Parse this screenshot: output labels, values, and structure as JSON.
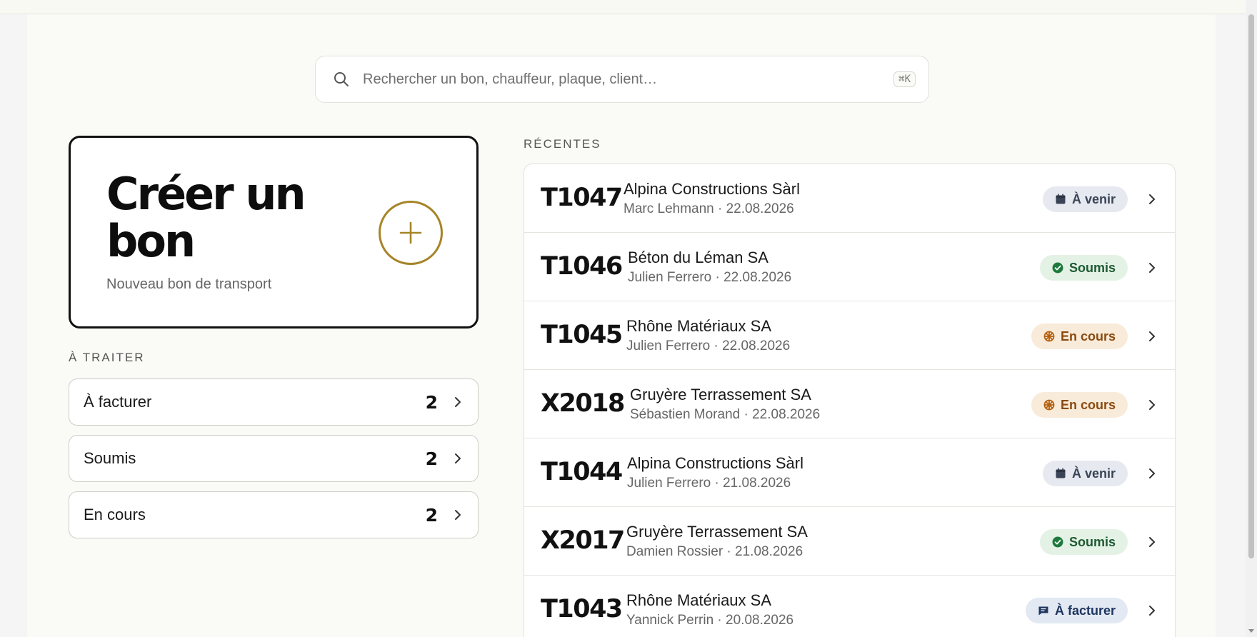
{
  "search": {
    "placeholder": "Rechercher un bon, chauffeur, plaque, client…",
    "shortcut": "⌘K"
  },
  "create_card": {
    "title": "Créer un bon",
    "subtitle": "Nouveau bon de transport"
  },
  "todo": {
    "label": "À TRAITER",
    "items": [
      {
        "label": "À facturer",
        "count": "2"
      },
      {
        "label": "Soumis",
        "count": "2"
      },
      {
        "label": "En cours",
        "count": "2"
      }
    ]
  },
  "recent": {
    "label": "RÉCENTES",
    "rows": [
      {
        "code": "T1047",
        "client": "Alpina Constructions Sàrl",
        "meta": "Marc Lehmann · 22.08.2026",
        "status": "À venir",
        "status_kind": "avenir"
      },
      {
        "code": "T1046",
        "client": "Béton du Léman SA",
        "meta": "Julien Ferrero · 22.08.2026",
        "status": "Soumis",
        "status_kind": "soumis"
      },
      {
        "code": "T1045",
        "client": "Rhône Matériaux SA",
        "meta": "Julien Ferrero · 22.08.2026",
        "status": "En cours",
        "status_kind": "encours"
      },
      {
        "code": "X2018",
        "client": "Gruyère Terrassement SA",
        "meta": "Sébastien Morand · 22.08.2026",
        "status": "En cours",
        "status_kind": "encours"
      },
      {
        "code": "T1044",
        "client": "Alpina Constructions Sàrl",
        "meta": "Julien Ferrero · 21.08.2026",
        "status": "À venir",
        "status_kind": "avenir"
      },
      {
        "code": "X2017",
        "client": "Gruyère Terrassement SA",
        "meta": "Damien Rossier · 21.08.2026",
        "status": "Soumis",
        "status_kind": "soumis"
      },
      {
        "code": "T1043",
        "client": "Rhône Matériaux SA",
        "meta": "Yannick Perrin · 20.08.2026",
        "status": "À facturer",
        "status_kind": "afacturer"
      }
    ]
  },
  "colors": {
    "accent": "#a68428",
    "card_border": "#111111",
    "status_avenir": "#3a4456",
    "status_soumis": "#1e7a3c",
    "status_encours": "#b5600f",
    "status_afacturer": "#1e3660"
  }
}
